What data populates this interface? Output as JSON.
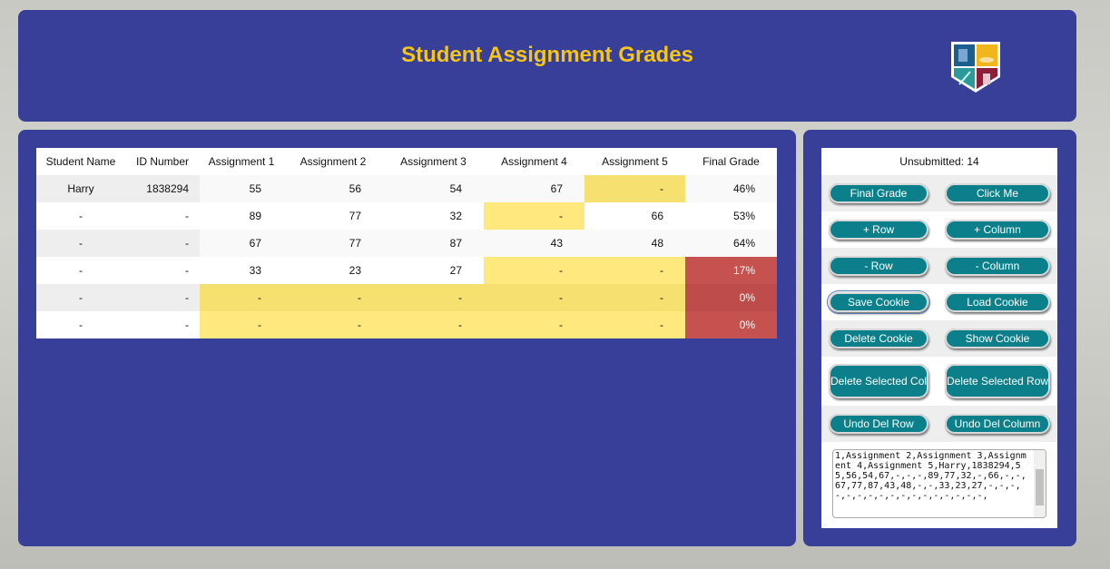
{
  "header": {
    "title": "Student Assignment Grades"
  },
  "table": {
    "columns": [
      "Student Name",
      "ID Number",
      "Assignment 1",
      "Assignment 2",
      "Assignment 3",
      "Assignment 4",
      "Assignment 5",
      "Final Grade"
    ],
    "rows": [
      [
        "Harry",
        "1838294",
        "55",
        "56",
        "54",
        "67",
        "-",
        "46%"
      ],
      [
        "-",
        "-",
        "89",
        "77",
        "32",
        "-",
        "66",
        "53%"
      ],
      [
        "-",
        "-",
        "67",
        "77",
        "87",
        "43",
        "48",
        "64%"
      ],
      [
        "-",
        "-",
        "33",
        "23",
        "27",
        "-",
        "-",
        "17%"
      ],
      [
        "-",
        "-",
        "-",
        "-",
        "-",
        "-",
        "-",
        "0%"
      ],
      [
        "-",
        "-",
        "-",
        "-",
        "-",
        "-",
        "-",
        "0%"
      ]
    ]
  },
  "sidebar": {
    "unsubmitted": "Unsubmitted: 14",
    "buttons": [
      [
        "Final Grade",
        "Click Me"
      ],
      [
        "+ Row",
        "+ Column"
      ],
      [
        "- Row",
        "- Column"
      ],
      [
        "Save Cookie",
        "Load Cookie"
      ],
      [
        "Delete Cookie",
        "Show Cookie"
      ],
      [
        "Delete Selected Col",
        "Delete Selected Row"
      ],
      [
        "Undo Del Row",
        "Undo Del Column"
      ]
    ],
    "textarea": "1,Assignment 2,Assignment 3,Assignment 4,Assignment 5,Harry,1838294,55,56,54,67,-,-,-,89,77,32,-,66,-,-,67,77,87,43,48,-,-,33,23,27,-,-,-,-,-,-,-,-,-,-,-,-,-,-,-,-,-,"
  },
  "colors": {
    "panel": "#373f98",
    "title": "#f5c518",
    "button": "#0b808a",
    "missing": "#ffe97f",
    "fail": "#c5524f"
  }
}
